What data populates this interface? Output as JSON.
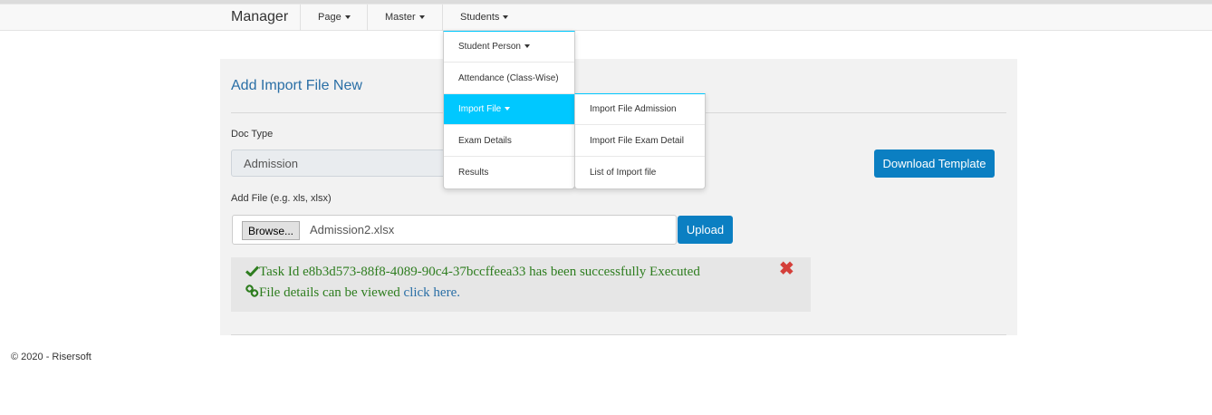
{
  "navbar": {
    "brand": "Manager",
    "items": [
      {
        "label": "Page"
      },
      {
        "label": "Master"
      },
      {
        "label": "Students"
      }
    ]
  },
  "students_menu": {
    "items": [
      {
        "label": "Student Person"
      },
      {
        "label": "Attendance (Class-Wise)"
      },
      {
        "label": "Import File"
      },
      {
        "label": "Exam Details"
      },
      {
        "label": "Results"
      }
    ]
  },
  "import_submenu": {
    "items": [
      {
        "label": "Import File Admission"
      },
      {
        "label": "Import File Exam Detail"
      },
      {
        "label": "List of Import file"
      }
    ]
  },
  "form": {
    "title": "Add Import File New",
    "doc_type_label": "Doc Type",
    "doc_type_value": "Admission",
    "download_button": "Download Template",
    "add_file_label": "Add File (e.g. xls, xlsx)",
    "browse_button": "Browse...",
    "file_name": "Admission2.xlsx",
    "upload_button": "Upload"
  },
  "alert": {
    "task_message": "Task Id e8b3d573-88f8-4089-90c4-37bccffeea33 has been successfully Executed",
    "details_prefix": "File details can be viewed",
    "details_link": "click here.",
    "success_color": "#2e7d1f",
    "close_color": "#d43f3a"
  },
  "footer": {
    "text": "© 2020 - Risersoft"
  },
  "colors": {
    "primary_button": "#0b7fc2",
    "active_menu": "#00c8ff",
    "title": "#2a6fa6"
  }
}
